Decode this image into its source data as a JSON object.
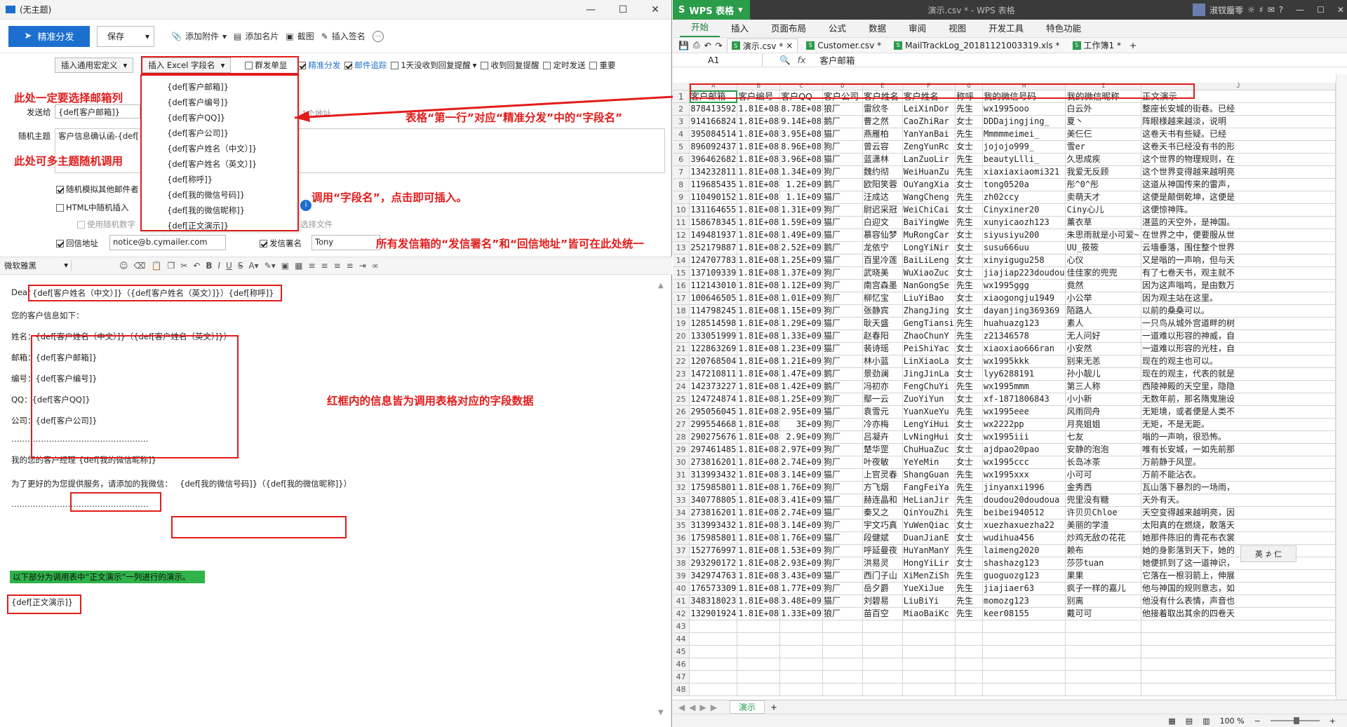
{
  "mail": {
    "window_title": "(无主题)",
    "toolbar": {
      "send_label": "精准分发",
      "save_label": "保存",
      "attach_label": "添加附件",
      "card_label": "添加名片",
      "screenshot_label": "截图",
      "signature_label": "插入签名"
    },
    "options": {
      "macro_label": "插入通用宏定义",
      "excel_label": "插入 Excel 字段名",
      "group_single": "群发单显",
      "precise": "精准分发",
      "tracking": "邮件追踪",
      "remind_1day": "1天没收到回复提醒",
      "reply_remind": "收到回复提醒",
      "timed_send": "定时发送",
      "important": "重要"
    },
    "excel_fields": [
      "{def[客户邮箱]}",
      "{def[客户编号]}",
      "{def[客户QQ]}",
      "{def[客户公司]}",
      "{def[客户姓名（中文）]}",
      "{def[客户姓名（英文）]}",
      "{def[称呼]}",
      "{def[我的微信号码]}",
      "{def[我的微信昵称]}",
      "{def[正文演示]}"
    ],
    "fields": {
      "to_label": "发送给",
      "to_value": "{def[客户邮箱]}",
      "to_hint": "1个地址",
      "subject_label": "随机主题",
      "subject_value": "客户信息确认函-{def[",
      "rand_attach": "随机模拟其他邮件者",
      "html_rand": "HTML中随机插入",
      "use_rand": "使用随机数字",
      "select_file": "选择文件",
      "reply_label": "回信地址",
      "reply_value": "notice@b.cymailer.com",
      "sender_sig_label": "发信署名",
      "sender_sig_value": "Tony"
    },
    "format": {
      "font": "微软雅黑"
    },
    "body": {
      "dear_prefix": "Dear",
      "dear_tokens": "{def[客户姓名（中文）]}（{def[客户姓名（英文）]}）{def[称呼]}",
      "info_title": "您的客户信息如下：",
      "name_line": "姓名：{def[客户姓名（中文）]}（{def[客户姓名（英文）]}）",
      "email_line": "邮箱：{def[客户邮箱]}",
      "id_line": "编号：{def[客户编号]}",
      "qq_line": "QQ：{def[客户QQ]}",
      "company_line": "公司：{def[客户公司]}",
      "dashes": "……………………………………………",
      "manager_prefix": "我的您的客户经理",
      "manager_token": "{def[我的微信昵称]}",
      "service_prefix": "为了更好的为您提供服务，请添加的我微信：",
      "service_token": "{def[我的微信号码]}（{def[我的微信昵称]}）",
      "dashes2": "……………………………………………",
      "green_note": "以下部分为调用表中“正文演示”一列进行的演示。",
      "demo_token": "{def[正文演示]}"
    },
    "annotations": {
      "a1": "此处一定要选择邮箱列",
      "a2": "此处可多主题随机调用",
      "a3": "表格“第一行”对应“精准分发”中的“字段名”",
      "a4": "调用“字段名”，点击即可插入。",
      "a5": "所有发信箱的“发信署名”和“回信地址”皆可在此处统一",
      "a6": "红框内的信息皆为调用表格对应的字段数据"
    }
  },
  "wps": {
    "app_name": "WPS 表格",
    "doc_title": "演示.csv * - WPS 表格",
    "user": "淑钗蜃零",
    "menu": [
      "开始",
      "插入",
      "页面布局",
      "公式",
      "数据",
      "审阅",
      "视图",
      "开发工具",
      "特色功能"
    ],
    "file_tabs": [
      "演示.csv *",
      "Customer.csv *",
      "MailTrackLog_20181121003319.xls *",
      "工作簿1 *"
    ],
    "name_box": "A1",
    "formula_value": "客户邮箱",
    "columns": [
      "A",
      "B",
      "C",
      "D",
      "E",
      "F",
      "G",
      "H",
      "I",
      "J"
    ],
    "header_row": [
      "客户邮箱",
      "客户编号",
      "客户QQ",
      "客户公司",
      "客户姓名",
      "客户姓名",
      "称呼",
      "我的微信号码",
      "我的微信昵称",
      "正文演示"
    ],
    "rows": [
      [
        "878413592",
        "1.81E+08",
        "8.78E+08",
        "狼厂",
        "雷欣冬",
        "LeiXinDor",
        "先生",
        "wx1995ooo",
        "白云外",
        "整座长安城的街巷。已经"
      ],
      [
        "914166824",
        "1.81E+08",
        "9.14E+08",
        "鹅厂",
        "曹之然",
        "CaoZhiRar",
        "女士",
        "DDDajingjing_",
        "夏丶",
        "阵眼様越来越淡，说明"
      ],
      [
        "395084514",
        "1.81E+08",
        "3.95E+08",
        "猫厂",
        "燕雁柏",
        "YanYanBai",
        "先生",
        "Mmmmmeimei_",
        "美仨仨",
        "这卷天书有些疑。已经"
      ],
      [
        "896092437",
        "1.81E+08",
        "8.96E+08",
        "狗厂",
        "曾云容",
        "ZengYunRc",
        "女士",
        "jojojo999_",
        "雪er",
        "这卷天书已经没有书的形"
      ],
      [
        "396462682",
        "1.81E+08",
        "3.96E+08",
        "猫厂",
        "蓝潇林",
        "LanZuoLir",
        "先生",
        "beautyLlli_",
        "久思成疾",
        "这个世界的物理规则，在"
      ],
      [
        "134232811",
        "1.81E+08",
        "1.34E+09",
        "狗厂",
        "魏约彻",
        "WeiHuanZu",
        "先生",
        "xiaxiaxiaomi321",
        "我爱无反顾",
        "这个世界变得越来越明亮"
      ],
      [
        "119685435",
        "1.81E+08",
        "1.2E+09",
        "鹅厂",
        "欧阳笑蓉",
        "OuYangXia",
        "女士",
        "tong0520a",
        "彤^0^彤",
        "这道从神国传来的雷声，"
      ],
      [
        "110490152",
        "1.81E+08",
        "1.1E+09",
        "猫厂",
        "汪成达",
        "WangCheng",
        "先生",
        "zh02ccy",
        "卖萌天才",
        "这便是颠倒乾坤，这便是"
      ],
      [
        "131164655",
        "1.81E+08",
        "1.31E+09",
        "狗厂",
        "尉迟采冠",
        "WeiChiCai",
        "女士",
        "Cinyxiner20",
        "Ciny心儿",
        "这便惊神阵。"
      ],
      [
        "158678345",
        "1.81E+08",
        "1.59E+09",
        "猫厂",
        "白迎文",
        "BaiYingWe",
        "先生",
        "xunyicaozh123",
        "薰衣草",
        "湛蓝的天空外，是神国。"
      ],
      [
        "149481937",
        "1.81E+08",
        "1.49E+09",
        "猫厂",
        "慕容仙梦",
        "MuRongCar",
        "女士",
        "siyusiyu200",
        "朱思雨就是小可爱~",
        "在世界之中，便要服从世"
      ],
      [
        "252179887",
        "1.81E+08",
        "2.52E+09",
        "鹅厂",
        "龙依宁",
        "LongYiNir",
        "女士",
        "susu666uu",
        "UU_筱筱",
        "云墙垂落，围住整个世界"
      ],
      [
        "124707783",
        "1.81E+08",
        "1.25E+09",
        "猫厂",
        "百里冷莲",
        "BaiLiLeng",
        "女士",
        "xinyigugu258",
        "心仪",
        "又是嗡的一声响，但与天"
      ],
      [
        "137109339",
        "1.81E+08",
        "1.37E+09",
        "狗厂",
        "武晓美",
        "WuXiaoZuc",
        "女士",
        "jiajiap223doudou",
        "佳佳家的兜兜",
        "有了七卷天书，观主就不"
      ],
      [
        "112143010",
        "1.81E+08",
        "1.12E+09",
        "狗厂",
        "南宫森墨",
        "NanGongSe",
        "先生",
        "wx1995ggg",
        "竟然",
        "因为这声嗡鸣，是由数万"
      ],
      [
        "100646505",
        "1.81E+08",
        "1.01E+09",
        "狗厂",
        "柳忆宝",
        "LiuYiBao",
        "女士",
        "xiaogongju1949",
        "小公举",
        "因为观主站在这里。"
      ],
      [
        "114798245",
        "1.81E+08",
        "1.15E+09",
        "狗厂",
        "张静宾",
        "ZhangJing",
        "女士",
        "dayanjing369369",
        "陌路人",
        "以前的桑桑可以。"
      ],
      [
        "128514598",
        "1.81E+08",
        "1.29E+09",
        "猫厂",
        "耿天盛",
        "GengTiansi",
        "先生",
        "huahuazg123",
        "素人",
        "一只鸟从城外宫道畔的树"
      ],
      [
        "133051999",
        "1.81E+08",
        "1.33E+09",
        "猫厂",
        "赵春阳",
        "ZhaoChunY",
        "先生",
        "z21346578",
        "无人问好",
        "一道难以形容的神威，自"
      ],
      [
        "122863269",
        "1.81E+08",
        "1.23E+09",
        "猫厂",
        "裴诗瑶",
        "PeiShiYac",
        "女士",
        "xiaoxiao666ran",
        "小安然",
        "一道难以形容的光柱，自"
      ],
      [
        "120768504",
        "1.81E+08",
        "1.21E+09",
        "狗厂",
        "林小蓝",
        "LinXiaoLa",
        "女士",
        "wx1995kkk",
        "别来无恙",
        "现在的观主也可以。"
      ],
      [
        "147210811",
        "1.81E+08",
        "1.47E+09",
        "鹅厂",
        "景劲澜",
        "JingJinLa",
        "女士",
        "lyy6288191",
        "孙小靓儿",
        "现在的观主，代表的就是"
      ],
      [
        "142373227",
        "1.81E+08",
        "1.42E+09",
        "鹅厂",
        "冯初亦",
        "FengChuYi",
        "先生",
        "wx1995mmm",
        "第三人称",
        "西陵神殿的天空里，隐隐"
      ],
      [
        "124724874",
        "1.81E+08",
        "1.25E+09",
        "狗厂",
        "鄢一云",
        "ZuoYiYun",
        "女士",
        "xf-1871806843",
        "小小新",
        "无数年前，那名隋鬼施设"
      ],
      [
        "295056045",
        "1.81E+08",
        "2.95E+09",
        "猫厂",
        "袁雪元",
        "YuanXueYu",
        "先生",
        "wx1995eee",
        "风雨同舟",
        "无矩境，或者便是人类不"
      ],
      [
        "299554668",
        "1.81E+08",
        "3E+09",
        "狗厂",
        "冷亦梅",
        "LengYiHui",
        "女士",
        "wx2222pp",
        "月亮姐姐",
        "无矩，不是无距。"
      ],
      [
        "290275676",
        "1.81E+08",
        "2.9E+09",
        "狗厂",
        "吕凝卉",
        "LvNingHui",
        "女士",
        "wx1995iii",
        "七友",
        "嗡的一声响，很恐怖。"
      ],
      [
        "297461485",
        "1.81E+08",
        "2.97E+09",
        "狗厂",
        "楚华罡",
        "ChuHuaZuc",
        "女士",
        "ajdpao20pao",
        "安静的泡泡",
        "唯有长安城，一如先前那"
      ],
      [
        "273816201",
        "1.81E+08",
        "2.74E+09",
        "狗厂",
        "叶夜敏",
        "YeYeMin",
        "女士",
        "wx1995ccc",
        "长岛冰茶",
        "万前静于风罡。"
      ],
      [
        "313993432",
        "1.81E+08",
        "3.14E+09",
        "猫厂",
        "上官灵春",
        "ShangGuan",
        "先生",
        "wx1995xxx",
        "小可可",
        "万前不能沾衣。"
      ],
      [
        "175985801",
        "1.81E+08",
        "1.76E+09",
        "狗厂",
        "方飞烟",
        "FangFeiYa",
        "先生",
        "jinyanxi1996",
        "金秀西",
        "瓦山落下暴烈的一场雨，"
      ],
      [
        "340778805",
        "1.81E+08",
        "3.41E+09",
        "猫厂",
        "赫连晶和",
        "HeLianJir",
        "先生",
        "doudou20doudoua",
        "兜里没有糖",
        "天外有天。"
      ],
      [
        "273816201",
        "1.81E+08",
        "2.74E+09",
        "猫厂",
        "秦又之",
        "QinYouZhi",
        "先生",
        "beibei940512",
        "许贝贝Chloe",
        "天空变得越来越明亮，因"
      ],
      [
        "313993432",
        "1.81E+08",
        "3.14E+09",
        "狗厂",
        "宇文巧真",
        "YuWenQiac",
        "女士",
        "xuezhaxuezha22",
        "美丽的学渣",
        "太阳真的在燃烧，散落天"
      ],
      [
        "175985801",
        "1.81E+08",
        "1.76E+09",
        "猫厂",
        "段健斌",
        "DuanJianE",
        "女士",
        "wudihua456",
        "炒鸡无敌の花花",
        "她那件陈旧的青花布衣裳"
      ],
      [
        "152776997",
        "1.81E+08",
        "1.53E+09",
        "狗厂",
        "呼延曼夜",
        "HuYanManY",
        "先生",
        "laimeng2020",
        "赖布",
        "她的身影落到天下，她的"
      ],
      [
        "293290172",
        "1.81E+08",
        "2.93E+09",
        "狗厂",
        "洪易灵",
        "HongYiLir",
        "女士",
        "shashazg123",
        "莎莎tuan",
        "她便抓到了这一道神识，"
      ],
      [
        "342974763",
        "1.81E+08",
        "3.43E+09",
        "猫厂",
        "西门子山",
        "XiMenZiSh",
        "先生",
        "guoguozg123",
        "果果",
        "它落在一根羽箭上，伸展"
      ],
      [
        "176573309",
        "1.81E+08",
        "1.77E+09",
        "狗厂",
        "岳夕爵",
        "YueXiJue",
        "先生",
        "jiajiaer63",
        "疯子一样的嘉儿",
        "他与神国的规则意志，如"
      ],
      [
        "348318023",
        "1.81E+08",
        "3.48E+09",
        "猫厂",
        "刘碧易",
        "LiuBiYi",
        "先生",
        "momozg123",
        "别离",
        "他没有什么表情，声音也"
      ],
      [
        "132901924",
        "1.81E+08",
        "1.33E+09",
        "狼厂",
        "苗百空",
        "MiaoBaiKc",
        "先生",
        "keer08155",
        "戴可可",
        "他接着取出其余的四卷天"
      ]
    ],
    "empty_rows": [
      43,
      44,
      45,
      46,
      47,
      48
    ],
    "sheet_tab": "演示",
    "zoom": "100 %",
    "ime": "英 ⊅ 仁"
  }
}
